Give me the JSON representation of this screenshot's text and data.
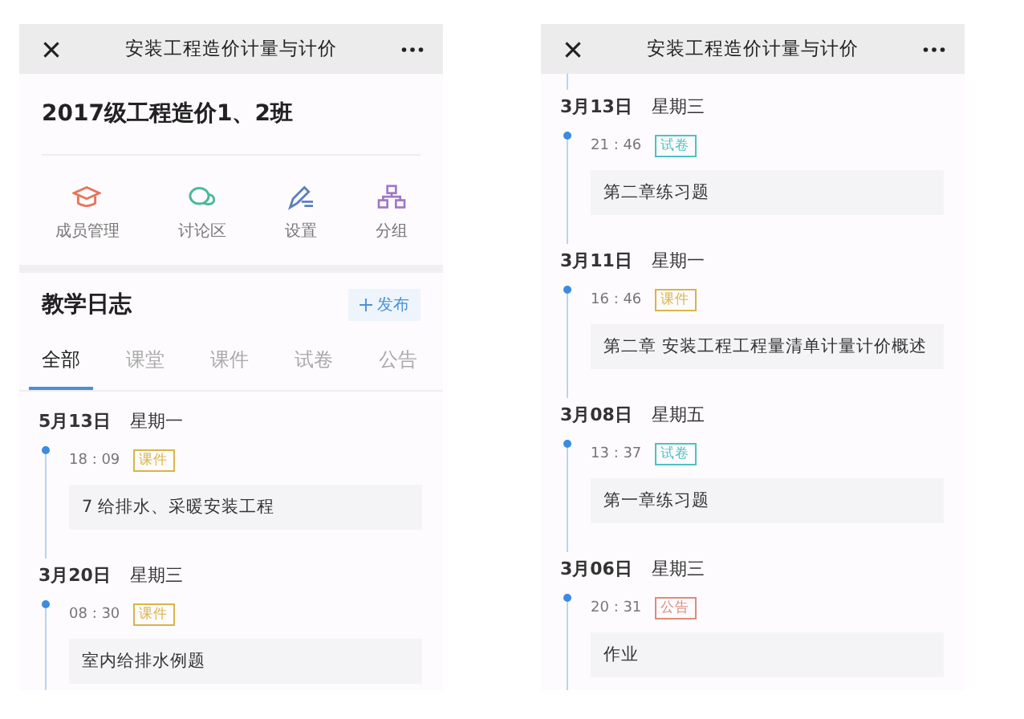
{
  "screens": [
    {
      "header": {
        "title": "安装工程造价计量与计价"
      },
      "class_name": "2017级工程造价1、2班",
      "actions": [
        {
          "label": "成员管理",
          "kind": "members"
        },
        {
          "label": "讨论区",
          "kind": "discussion"
        },
        {
          "label": "设置",
          "kind": "settings"
        },
        {
          "label": "分组",
          "kind": "groups"
        }
      ],
      "journal": {
        "title": "教学日志",
        "publish_button": "发布"
      },
      "tabs": [
        {
          "label": "全部",
          "selected": true
        },
        {
          "label": "课堂",
          "selected": false
        },
        {
          "label": "课件",
          "selected": false
        },
        {
          "label": "试卷",
          "selected": false
        },
        {
          "label": "公告",
          "selected": false
        }
      ],
      "entries": [
        {
          "date": "5月13日",
          "weekday": "星期一",
          "time": "18 : 09",
          "tag": "课件",
          "kind": "courseware",
          "content": "7 给排水、采暖安装工程"
        },
        {
          "date": "3月20日",
          "weekday": "星期三",
          "time": "08 : 30",
          "tag": "课件",
          "kind": "courseware",
          "content": "室内给排水例题"
        }
      ]
    },
    {
      "header": {
        "title": "安装工程造价计量与计价"
      },
      "entries": [
        {
          "date": "3月13日",
          "weekday": "星期三",
          "time": "21 : 46",
          "tag": "试卷",
          "kind": "exam",
          "content": "第二章练习题"
        },
        {
          "date": "3月11日",
          "weekday": "星期一",
          "time": "16 : 46",
          "tag": "课件",
          "kind": "courseware",
          "content": "第二章 安装工程工程量清单计量计价概述"
        },
        {
          "date": "3月08日",
          "weekday": "星期五",
          "time": "13 : 37",
          "tag": "试卷",
          "kind": "exam",
          "content": "第一章练习题"
        },
        {
          "date": "3月06日",
          "weekday": "星期三",
          "time": "20 : 31",
          "tag": "公告",
          "kind": "notice",
          "content": "作业"
        }
      ]
    }
  ]
}
